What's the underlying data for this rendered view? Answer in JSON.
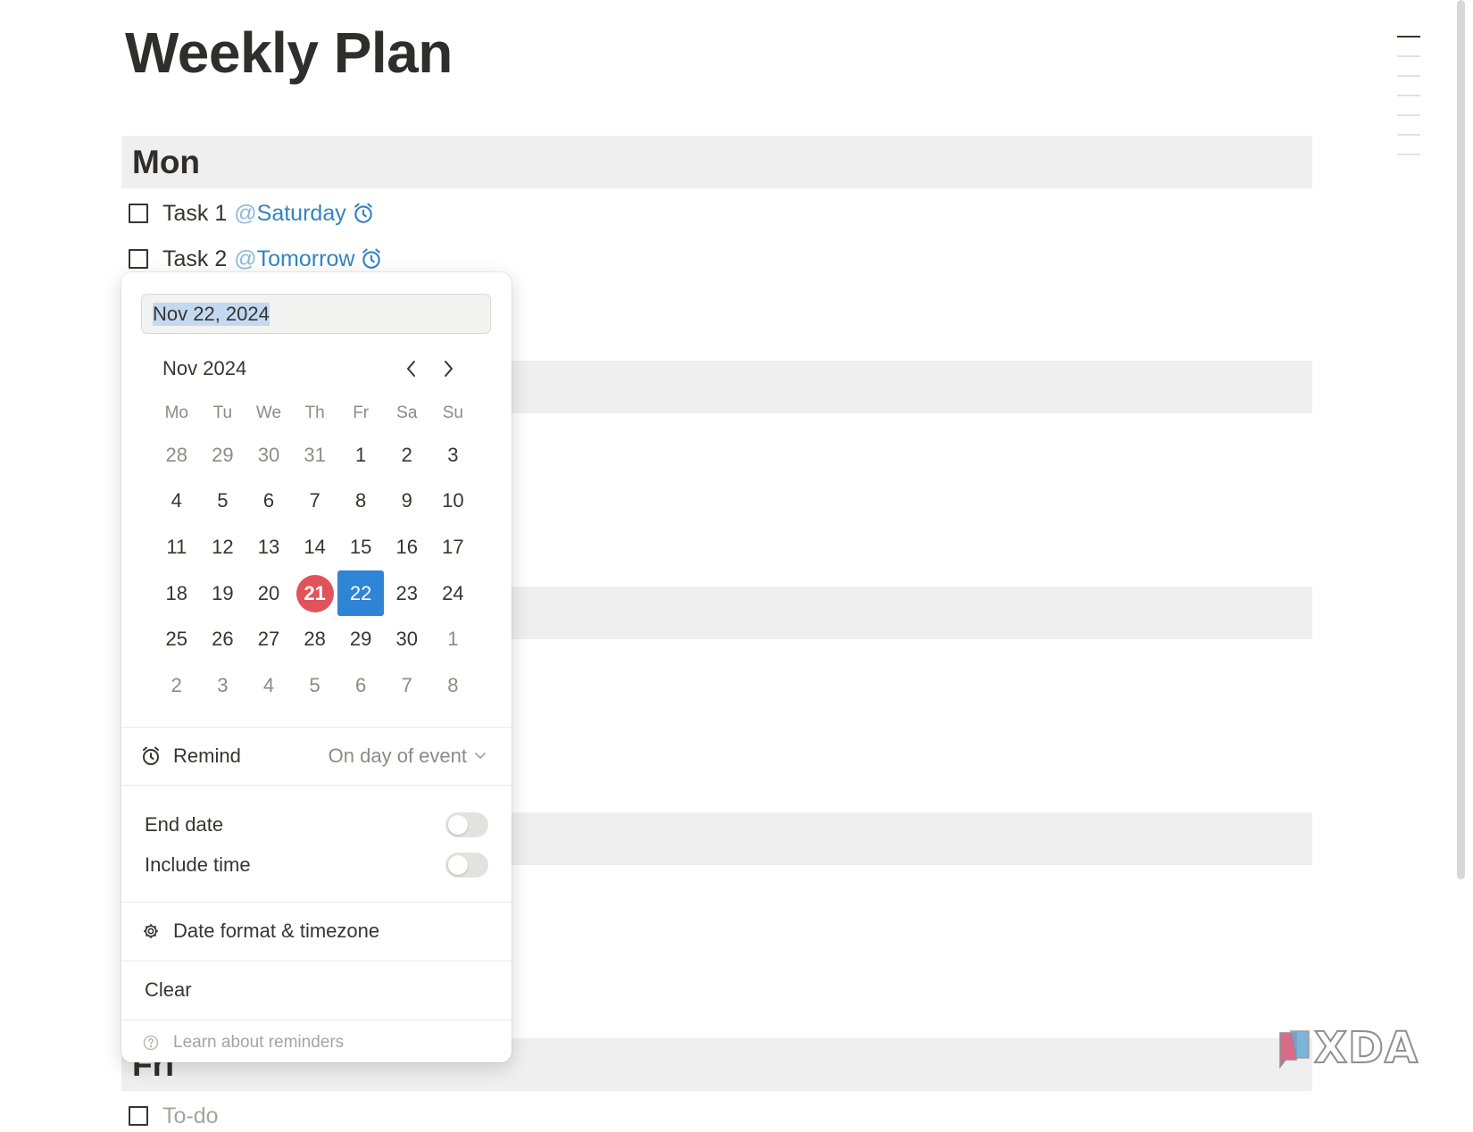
{
  "page": {
    "title": "Weekly Plan"
  },
  "days": {
    "mon": "Mon",
    "fri": "Fri"
  },
  "tasks": [
    {
      "label": "Task 1",
      "mention": "Saturday"
    },
    {
      "label": "Task 2",
      "mention": "Tomorrow"
    }
  ],
  "fri_todo_placeholder": "To-do",
  "date_picker": {
    "input_value": "Nov 22, 2024",
    "month_label": "Nov 2024",
    "weekdays": [
      "Mo",
      "Tu",
      "We",
      "Th",
      "Fr",
      "Sa",
      "Su"
    ],
    "weeks": [
      [
        "28",
        "29",
        "30",
        "31",
        "1",
        "2",
        "3"
      ],
      [
        "4",
        "5",
        "6",
        "7",
        "8",
        "9",
        "10"
      ],
      [
        "11",
        "12",
        "13",
        "14",
        "15",
        "16",
        "17"
      ],
      [
        "18",
        "19",
        "20",
        "21",
        "22",
        "23",
        "24"
      ],
      [
        "25",
        "26",
        "27",
        "28",
        "29",
        "30",
        "1"
      ],
      [
        "2",
        "3",
        "4",
        "5",
        "6",
        "7",
        "8"
      ]
    ],
    "today": "21",
    "selected": "22",
    "remind_label": "Remind",
    "remind_value": "On day of event",
    "end_date_label": "End date",
    "end_date_enabled": false,
    "include_time_label": "Include time",
    "include_time_enabled": false,
    "date_format_label": "Date format & timezone",
    "clear_label": "Clear",
    "learn_label": "Learn about reminders"
  },
  "watermark": {
    "text": "XDA"
  },
  "colors": {
    "accent_blue": "#2f84d6",
    "today_red": "#e0535b",
    "mention_blue": "#3483c4",
    "header_gray": "#efefef"
  },
  "icons": {
    "alarm": "alarm-clock-icon",
    "gear": "gear-icon",
    "help": "question-circle-icon",
    "chevron_left": "chevron-left-icon",
    "chevron_right": "chevron-right-icon",
    "chevron_down": "chevron-down-icon"
  }
}
